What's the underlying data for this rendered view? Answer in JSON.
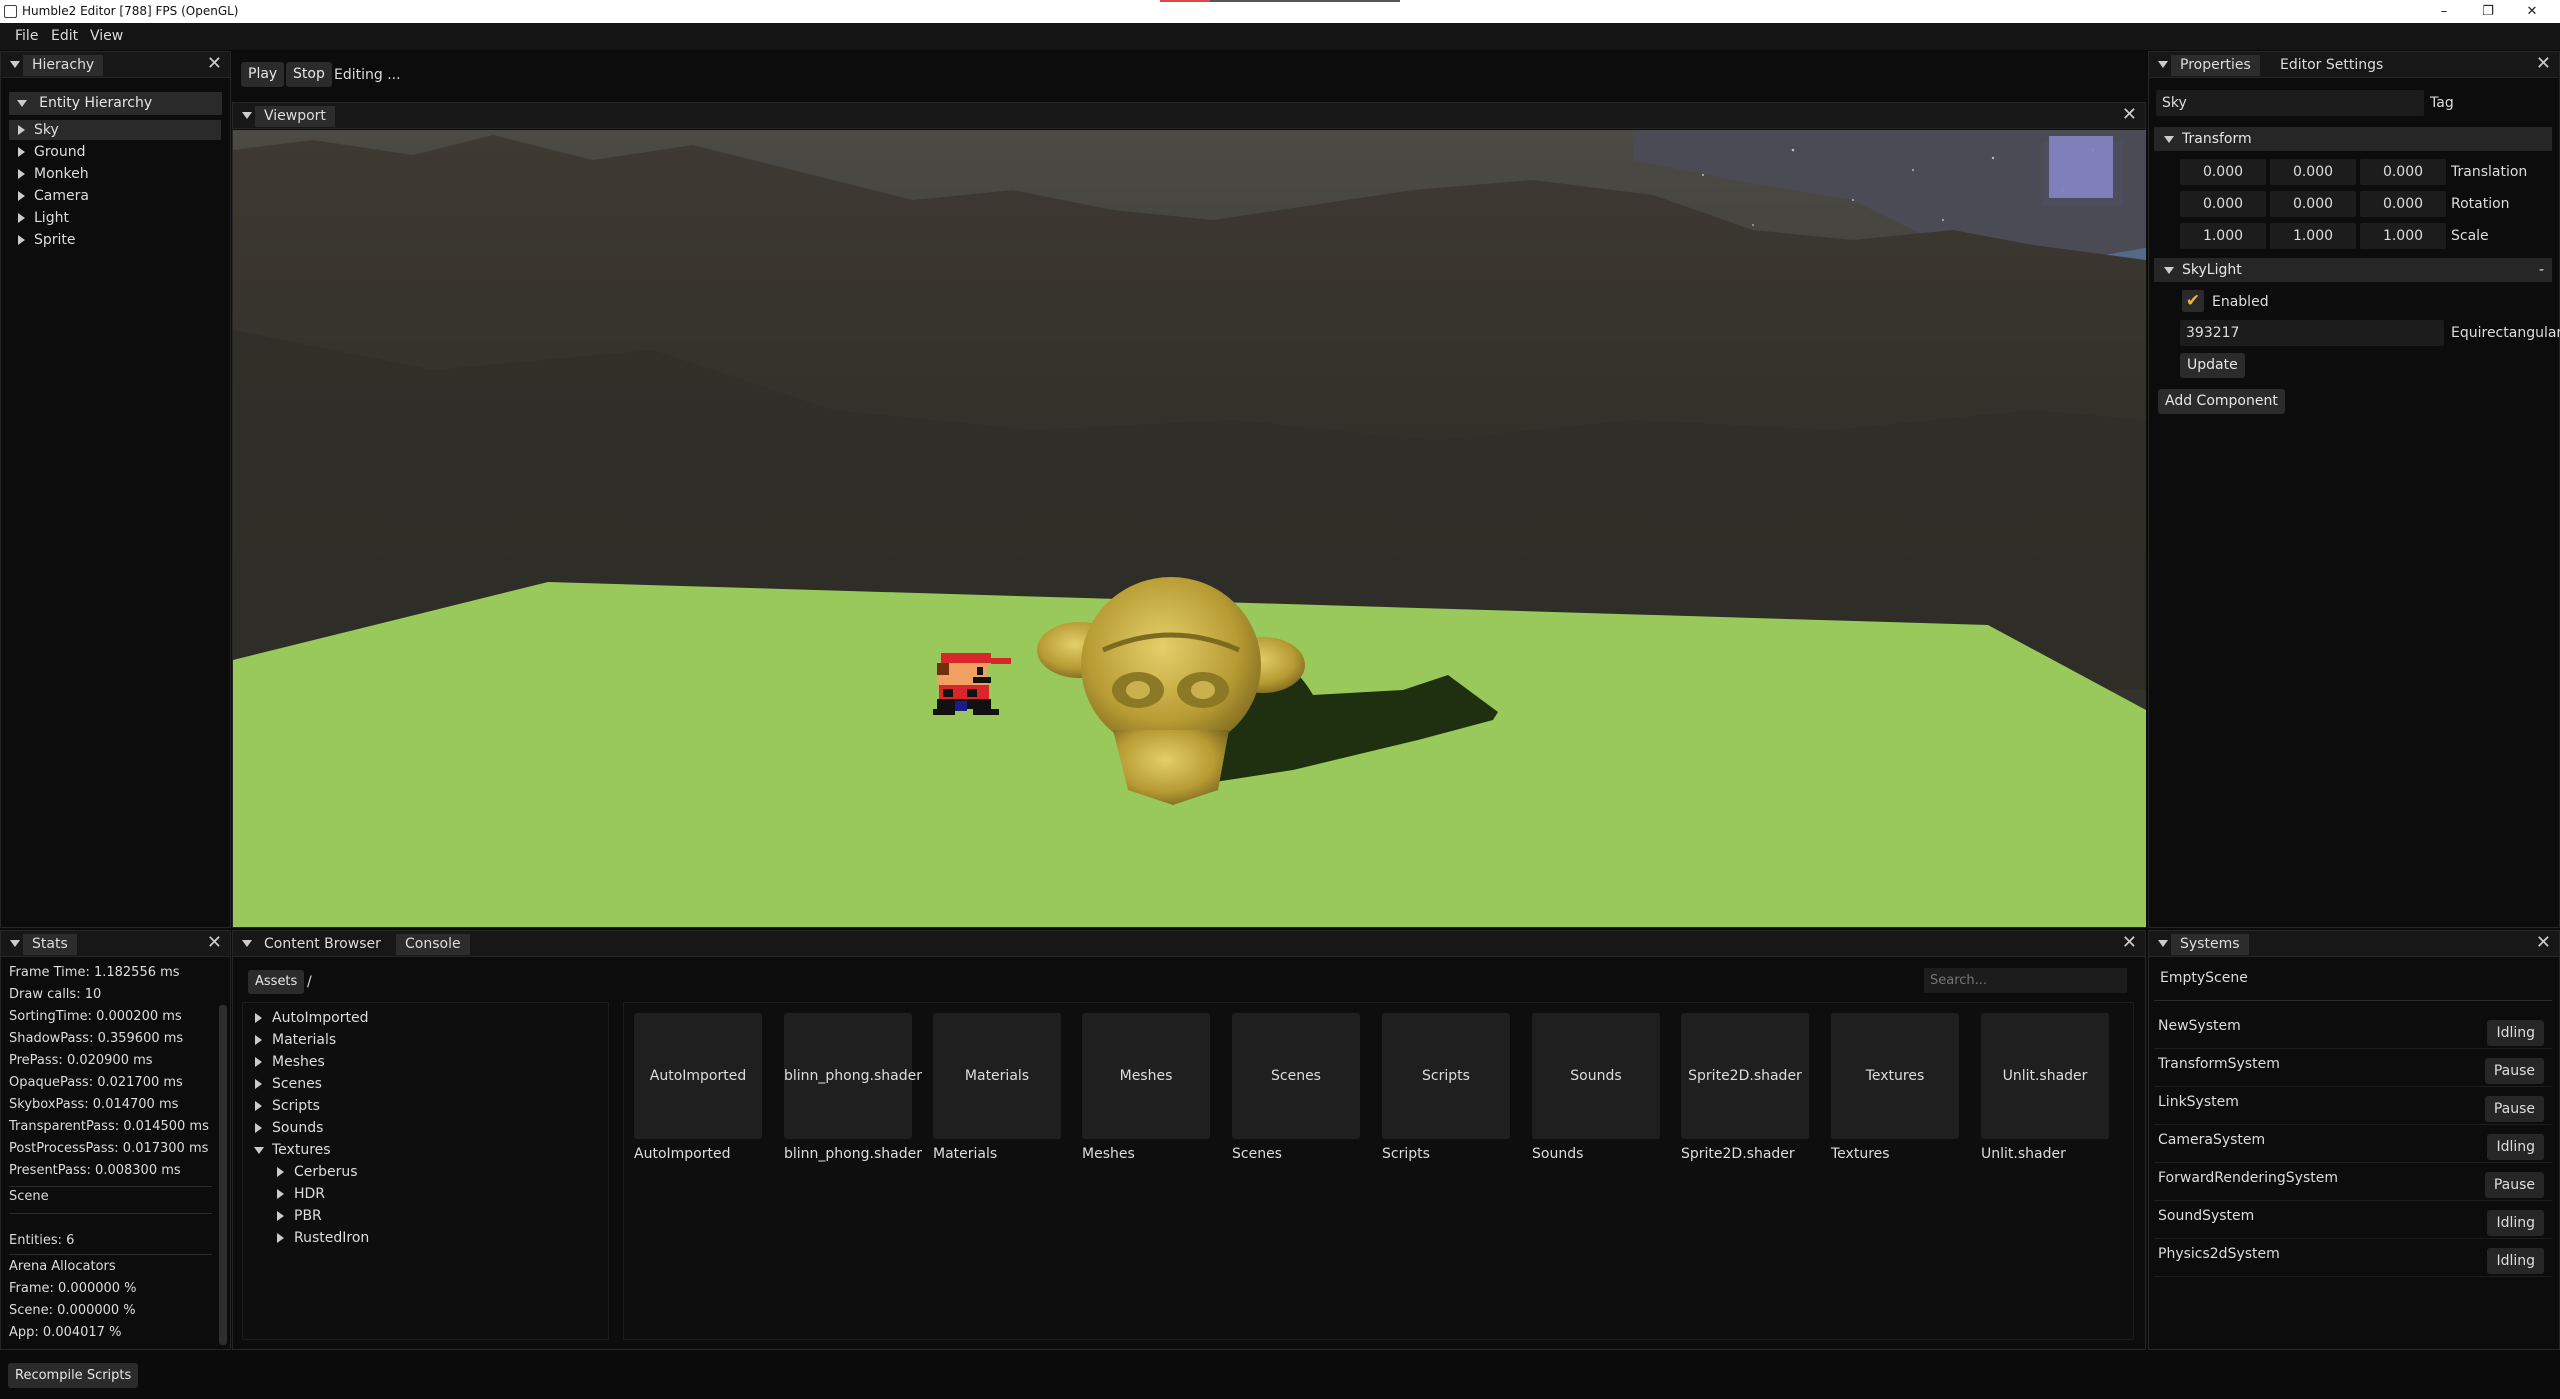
{
  "window": {
    "title": "Humble2 Editor [788] FPS (OpenGL)",
    "minimize": "–",
    "restore": "❐",
    "close": "✕"
  },
  "menu": {
    "items": [
      "File",
      "Edit",
      "View"
    ]
  },
  "hierarchy": {
    "tab": "Hierachy",
    "root": "Entity Hierarchy",
    "entities": [
      "Sky",
      "Ground",
      "Monkeh",
      "Camera",
      "Light",
      "Sprite"
    ],
    "selected": "Sky"
  },
  "toolbar": {
    "play": "Play",
    "stop": "Stop",
    "status": "Editing ..."
  },
  "viewport": {
    "tab": "Viewport"
  },
  "properties": {
    "tabs": [
      "Properties",
      "Editor Settings"
    ],
    "entity_name": "Sky",
    "tag_label": "Tag",
    "transform": {
      "header": "Transform",
      "translation": [
        "0.000",
        "0.000",
        "0.000"
      ],
      "rotation": [
        "0.000",
        "0.000",
        "0.000"
      ],
      "scale": [
        "1.000",
        "1.000",
        "1.000"
      ],
      "labels": [
        "Translation",
        "Rotation",
        "Scale"
      ]
    },
    "skylight": {
      "header": "SkyLight",
      "collapse": "-",
      "enabled_label": "Enabled",
      "enabled": true,
      "texture_value": "393217",
      "texture_label": "Equirectangular I",
      "update": "Update"
    },
    "add_component": "Add Component"
  },
  "stats": {
    "tab": "Stats",
    "lines": [
      "Frame Time: 1.182556 ms",
      "Draw calls: 10",
      "SortingTime: 0.000200 ms",
      "ShadowPass: 0.359600 ms",
      "PrePass: 0.020900 ms",
      "OpaquePass: 0.021700 ms",
      "SkyboxPass: 0.014700 ms",
      "TransparentPass: 0.014500 ms",
      "PostProcessPass: 0.017300 ms",
      "PresentPass: 0.008300 ms"
    ],
    "scene_header": "Scene",
    "entities": "Entities: 6",
    "arena_header": "Arena Allocators",
    "arena_lines": [
      "Frame: 0.000000 %",
      "Scene: 0.000000 %",
      "App: 0.004017 %"
    ]
  },
  "content_browser": {
    "tabs": [
      "Content Browser",
      "Console"
    ],
    "assets_button": "Assets",
    "path": "/",
    "search_placeholder": "Search...",
    "tree": [
      "AutoImported",
      "Materials",
      "Meshes",
      "Scenes",
      "Scripts",
      "Sounds",
      "Textures"
    ],
    "texture_children": [
      "Cerberus",
      "HDR",
      "PBR",
      "RustedIron"
    ],
    "items": [
      "AutoImported",
      "blinn_phong.shader",
      "Materials",
      "Meshes",
      "Scenes",
      "Scripts",
      "Sounds",
      "Sprite2D.shader",
      "Textures",
      "Unlit.shader"
    ]
  },
  "systems": {
    "tab": "Systems",
    "scene": "EmptyScene",
    "list": [
      {
        "name": "NewSystem",
        "state": "Idling"
      },
      {
        "name": "TransformSystem",
        "state": "Pause"
      },
      {
        "name": "LinkSystem",
        "state": "Pause"
      },
      {
        "name": "CameraSystem",
        "state": "Idling"
      },
      {
        "name": "ForwardRenderingSystem",
        "state": "Pause"
      },
      {
        "name": "SoundSystem",
        "state": "Idling"
      },
      {
        "name": "Physics2dSystem",
        "state": "Idling"
      }
    ]
  },
  "footer": {
    "recompile": "Recompile Scripts"
  },
  "colors": {
    "ground": "#98c95a",
    "accent": "#e04848"
  }
}
